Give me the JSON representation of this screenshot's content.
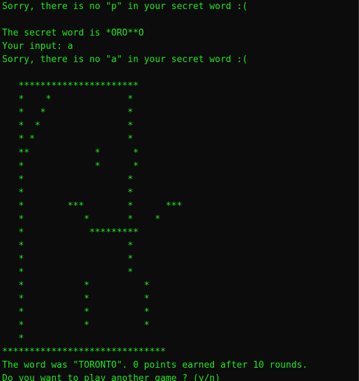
{
  "terminal": {
    "lines": [
      "Sorry, there is no \"p\" in your secret word :(",
      "",
      "The secret word is *ORO**O",
      "Your input: a",
      "Sorry, there is no \"a\" in your secret word :(",
      "",
      "   **********************",
      "   *    *              *",
      "   *   *               *",
      "   *  *                *",
      "   * *                 *",
      "   **            *      *",
      "   *             *      *",
      "   *                   *",
      "   *                   *",
      "   *        ***        *      ***",
      "   *           *       *    *",
      "   *            *********",
      "   *                   *",
      "   *                   *",
      "   *                   *",
      "   *           *          *",
      "   *           *          *",
      "   *           *          *",
      "   *           *          *",
      "   *",
      "******************************",
      "The word was \"TORONTO\". 0 points earned after 10 rounds.",
      "Do you want to play another game ? (y/n)",
      "-->"
    ]
  },
  "colors": {
    "background": "#0c0c0c",
    "text": "#1ee81e"
  }
}
